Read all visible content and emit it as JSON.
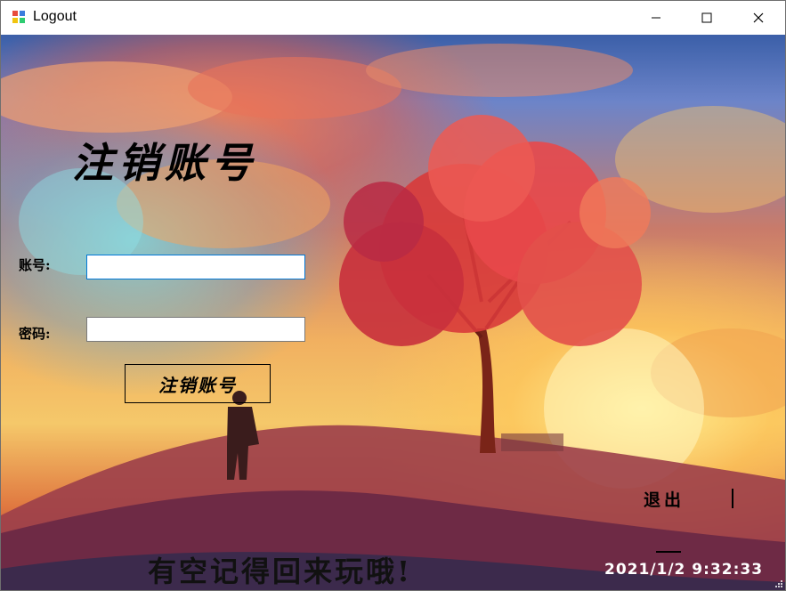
{
  "window": {
    "title": "Logout",
    "icon": "app-window-icon",
    "controls": {
      "minimize_icon": "minimize-icon",
      "maximize_icon": "maximize-icon",
      "close_icon": "close-icon"
    }
  },
  "form": {
    "heading": "注销账号",
    "account_label": "账号:",
    "account_value": "",
    "password_label": "密码:",
    "password_value": "",
    "submit_label": "注销账号"
  },
  "footer": {
    "exit_label": "退出",
    "message": "有空记得回来玩哦!",
    "datetime": "2021/1/2  9:32:33"
  },
  "colors": {
    "titlebar_bg": "#ffffff",
    "focus_border": "#0078d7",
    "text": "#000000",
    "clock_text": "#ffffff"
  }
}
